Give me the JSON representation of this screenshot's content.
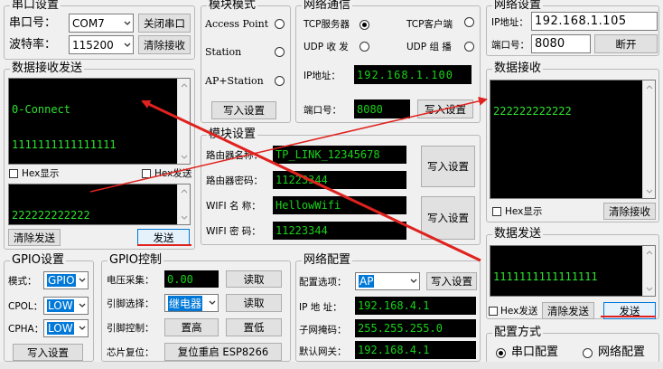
{
  "serial": {
    "title": "串口设置",
    "port_label": "串口号：",
    "port_value": "COM7",
    "close_button": "关闭串口",
    "baud_label": "波特率：",
    "baud_value": "115200",
    "clear_button": "清除接收"
  },
  "data_io": {
    "title": "数据接收发送",
    "receive_lines": [
      "0-Connect",
      "1111111111111111"
    ],
    "hex_display": "Hex显示",
    "hex_send": "Hex发送",
    "send_text": "222222222222",
    "clear_send_button": "清除发送",
    "send_button": "发送"
  },
  "module_mode": {
    "title": "模块模式",
    "options": [
      "Access Point",
      "Station",
      "AP+Station"
    ],
    "write_button": "写入设置"
  },
  "net_comm": {
    "title": "网络通信",
    "tcp_server": "TCP服务器",
    "tcp_client": "TCP客户端",
    "udp_send": "UDP 收 发",
    "udp_group": "UDP 组 播",
    "ip_label": "IP地址：",
    "ip_value": "192.168.1.100",
    "port_label": "端口号：",
    "port_value": "8080",
    "write_button": "写入设置"
  },
  "module_settings": {
    "title": "模块设置",
    "router_name_label": "路由器名称：",
    "router_name_value": "TP_LINK_12345678",
    "router_pwd_label": "路由器密码：",
    "router_pwd_value": "11223344",
    "wifi_name_label": "WIFI 名 称：",
    "wifi_name_value": "HellowWifi",
    "wifi_pwd_label": "WIFI 密 码：",
    "wifi_pwd_value": "11223344",
    "write_button_1": "写入设置",
    "write_button_2": "写入设置"
  },
  "gpio": {
    "title": "GPIO设置",
    "mode_label": "模式：",
    "mode_value": "GPIO",
    "cpol_label": "CPOL：",
    "cpol_value": "LOW",
    "cpha_label": "CPHA：",
    "cpha_value": "LOW",
    "write_button": "写入设置"
  },
  "gpio_ctrl": {
    "title": "GPIO控制",
    "voltage_label": "电压采集：",
    "voltage_value": "0.00",
    "read_button_1": "读取",
    "pin_select_label": "引脚选择：",
    "pin_select_value": "继电器",
    "read_button_2": "读取",
    "pin_ctrl_label": "引脚控制：",
    "set_high": "置高",
    "set_low": "置低",
    "chip_reset_label": "芯片复位：",
    "reset_button": "复位重启 ESP8266"
  },
  "net_config": {
    "title": "网络配置",
    "option_label": "配置选项：",
    "option_value": "AP",
    "write_button": "写入设置",
    "ip_label": "IP 地 址：",
    "ip_value": "192.168.4.1",
    "mask_label": "子网掩码：",
    "mask_value": "255.255.255.0",
    "gateway_label": "默认网关：",
    "gateway_value": "192.168.4.1"
  },
  "right_net": {
    "title": "网络设置",
    "ip_label": "IP地址：",
    "ip_value": "192.168.1.105",
    "port_label": "端口号：",
    "port_value": "8080",
    "disconnect_button": "断开"
  },
  "right_receive": {
    "title": "数据接收",
    "text": "222222222222",
    "hex_display": "Hex显示",
    "clear_button": "清除接收"
  },
  "right_send": {
    "title": "数据发送",
    "text": "1111111111111111",
    "hex_send": "Hex发送",
    "clear_button": "清除发送",
    "send_button": "发送"
  },
  "config_mode": {
    "title": "配置方式",
    "serial_option": "串口配置",
    "network_option": "网络配置"
  },
  "colors": {
    "annotation_arrow": "#e0221e",
    "lcd_text": "#19d219",
    "selection": "#0078d7"
  }
}
